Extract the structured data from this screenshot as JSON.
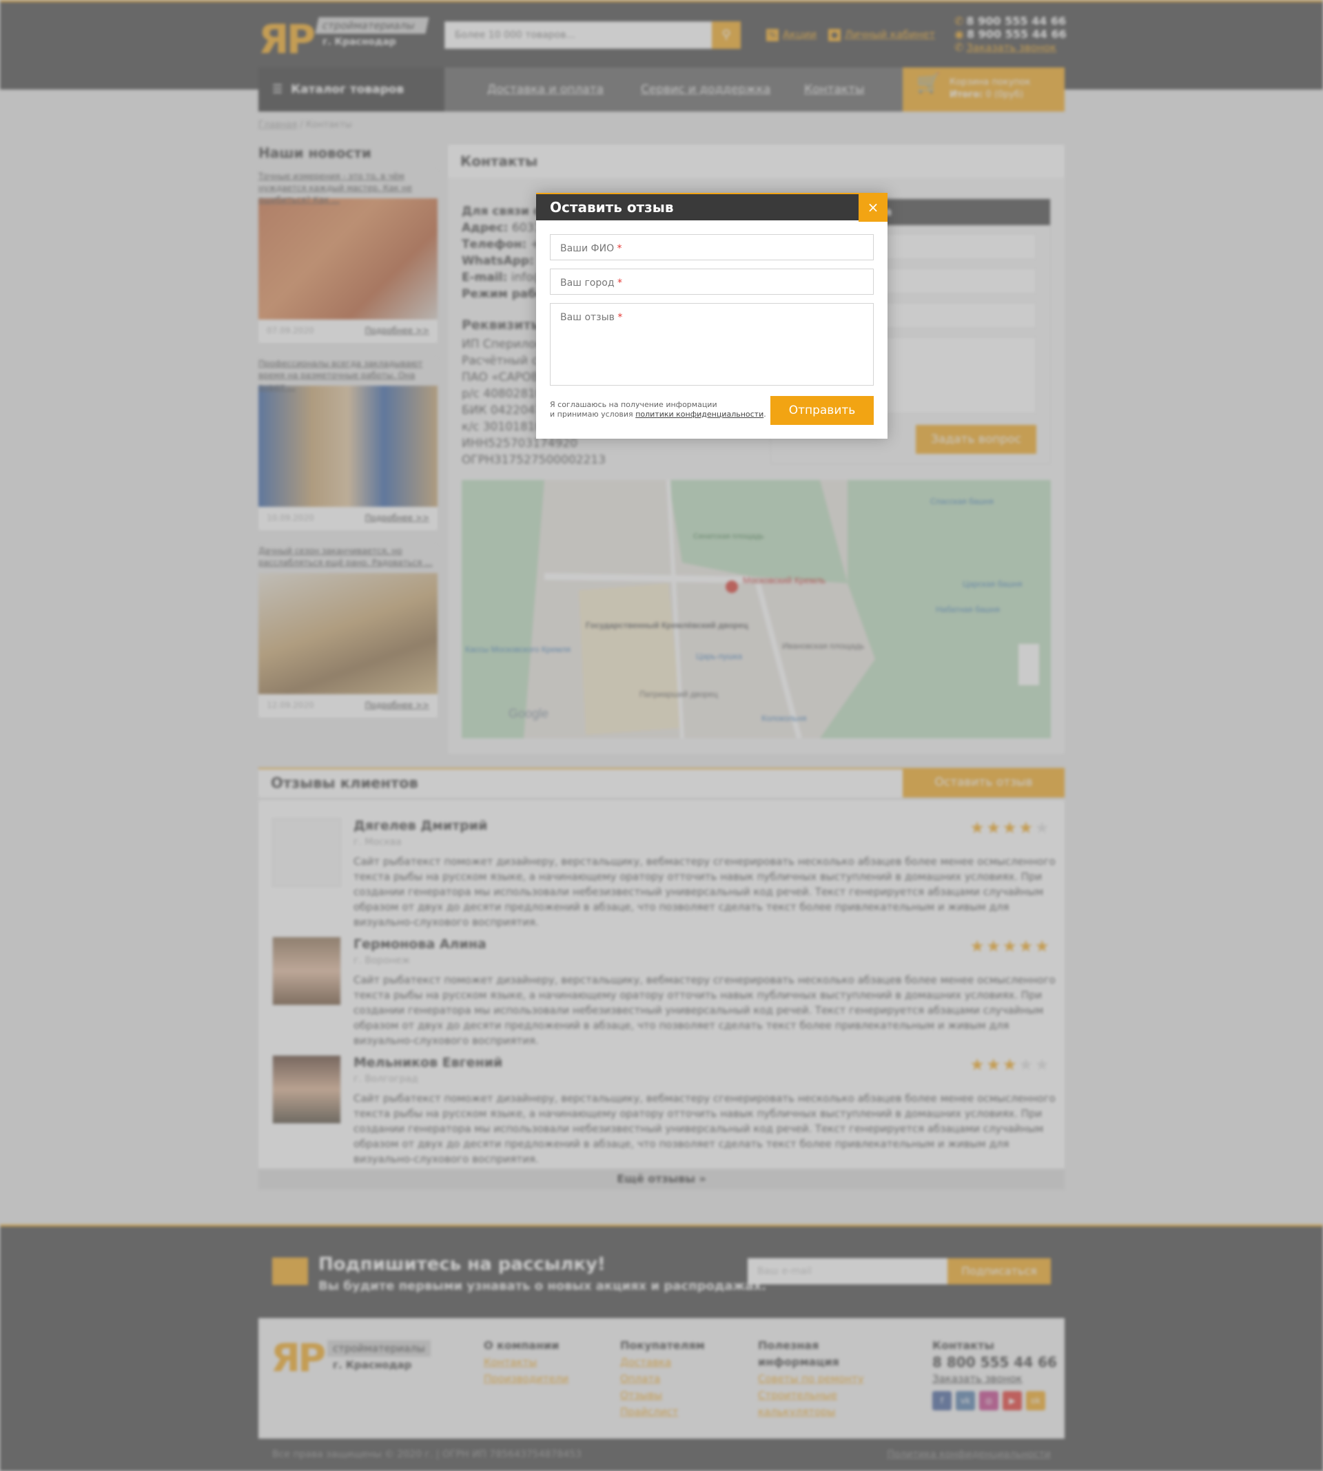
{
  "header": {
    "logo": "ЯР",
    "logo_tag_1": "стройматериалы",
    "logo_tag_2": "г. Краснодар",
    "search_placeholder": "Более 10 000 товаров...",
    "link_promo": "Акции",
    "link_account": "Личный кабинет",
    "phone_1": "8 900 555 44 66",
    "phone_2": "8 900 555 44 66",
    "callback": "Заказать звонок"
  },
  "nav": {
    "catalog": "Каталог товаров",
    "items": [
      "Доставка и оплата",
      "Сервис и доддержка",
      "Контакты"
    ],
    "cart_title": "Корзина покупок",
    "cart_total_label": "Итого:",
    "cart_total": "0 (0руб)"
  },
  "breadcrumb": {
    "home": "Главная",
    "current": "Контакты"
  },
  "news": {
    "title": "Наши новости",
    "more": "Подробнее >>",
    "items": [
      {
        "text": "Точные измерения - это то, в чём нуждается каждый мастер. Как не ошибиться? Как ...",
        "date": "07.09.2020"
      },
      {
        "text": "Профессионалы всегда закладывают время на разметочные работы. Она знают ...",
        "date": "10.09.2020"
      },
      {
        "text": "Дачный сезон заканчивается, но расслабляться ещё рано. Радоваться ...",
        "date": "12.09.2020"
      }
    ]
  },
  "contacts": {
    "title": "Контакты",
    "lines": [
      {
        "label": "Для связи с",
        "value": ""
      },
      {
        "label": "Адрес:",
        "value": "60310"
      },
      {
        "label": "Телефон:",
        "value": "+7 ("
      },
      {
        "label": "WhatsApp:",
        "value": "+"
      },
      {
        "label": "E-mail:",
        "value": "info@"
      },
      {
        "label": "Режим работ",
        "value": ""
      }
    ],
    "requisites_title": "Реквизиты",
    "requisites": [
      "ИП Сперилон",
      "Расчётный сч",
      "ПАО «САРОВБ",
      "р/с 40802810",
      "БИК 0422047",
      "к/с 30101810",
      "ИНН525703174920",
      "ОГРН317527500002213"
    ],
    "form_title": "ма",
    "form_button": "Задать вопрос",
    "map_labels": [
      "Московский Кремль",
      "Сенатская площадь",
      "Государственный Кремлёвский дворец",
      "Царь-пушка",
      "Ивановская площадь",
      "Спасская башня",
      "Царская башня",
      "Набатная башня",
      "Патриарший дворец",
      "Колокольня",
      "Кассы Московского Кремля",
      "Google"
    ]
  },
  "reviews": {
    "title": "Отзывы клиентов",
    "button": "Оставить отзыв",
    "more": "Ещё отзывы",
    "items": [
      {
        "name": "Дягелев Дмитрий",
        "city": "г. Москва",
        "rating": 4,
        "text": "Сайт рыбатекст поможет дизайнеру, верстальщику, вебмастеру сгенерировать несколько абзацев более менее осмысленного текста рыбы на русском языке, а начинающему оратору отточить навык публичных выступлений в домашних условиях. При создании генератора мы использовали небезизвестный универсальный код речей. Текст генерируется абзацами случайным образом от двух до десяти предложений в абзаце, что позволяет сделать текст более привлекательным и живым для визуально-слухового восприятия."
      },
      {
        "name": "Гермонова Алина",
        "city": "г. Воронеж",
        "rating": 5,
        "text": "Сайт рыбатекст поможет дизайнеру, верстальщику, вебмастеру сгенерировать несколько абзацев более менее осмысленного текста рыбы на русском языке, а начинающему оратору отточить навык публичных выступлений в домашних условиях. При создании генератора мы использовали небезизвестный универсальный код речей. Текст генерируется абзацами случайным образом от двух до десяти предложений в абзаце, что позволяет сделать текст более привлекательным и живым для визуально-слухового восприятия."
      },
      {
        "name": "Мельников Евгений",
        "city": "г. Волгоград",
        "rating": 3,
        "text": "Сайт рыбатекст поможет дизайнеру, верстальщику, вебмастеру сгенерировать несколько абзацев более менее осмысленного текста рыбы на русском языке, а начинающему оратору отточить навык публичных выступлений в домашних условиях. При создании генератора мы использовали небезизвестный универсальный код речей. Текст генерируется абзацами случайным образом от двух до десяти предложений в абзаце, что позволяет сделать текст более привлекательным и живым для визуально-слухового восприятия."
      }
    ]
  },
  "footer": {
    "sub_title": "Подпишитесь на рассылку!",
    "sub_text": "Вы будите первыми узнавать о новых акциях и распродажах.",
    "sub_placeholder": "Ваш e-mail",
    "sub_button": "Подписаться",
    "col_company": "О компании",
    "company_links": [
      "Контакты",
      "Производители"
    ],
    "col_buyers": "Покупателям",
    "buyers_links": [
      "Доставка",
      "Оплата",
      "Отзывы",
      "Прайслист"
    ],
    "col_useful": "Полезная информация",
    "useful_links": [
      "Советы по ремонту",
      "Строительные калькуляторы"
    ],
    "col_contacts": "Контакты",
    "phone": "8 800 555 44 66",
    "callback": "Заказать звонок",
    "copyright": "Все права защищены © 2020 г. | ОГРН ИП 785643754878453",
    "policy": "Политика конфиденциальности"
  },
  "modal": {
    "title": "Оставить отзыв",
    "close": "×",
    "field_name": "Ваши ФИО",
    "field_city": "Ваш город",
    "field_review": "Ваш отзыв",
    "required": "*",
    "consent_1": "Я соглашаюсь на получение информации",
    "consent_2": "и принимаю условия",
    "consent_link": "политики конфиденциальности",
    "submit": "Отправить"
  },
  "colors": {
    "accent": "#f2a413",
    "dark": "#3a3a3a"
  }
}
